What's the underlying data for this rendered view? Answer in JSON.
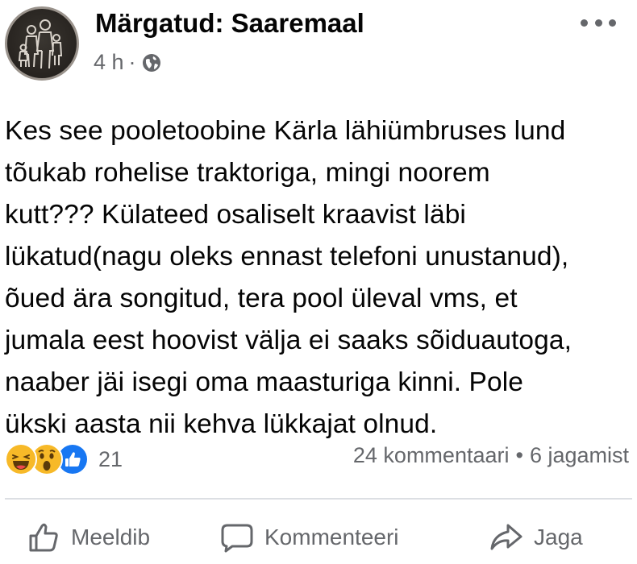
{
  "post": {
    "group_name": "Märgatud: Saaremaal",
    "time": "4 h",
    "separator": "·",
    "privacy_icon": "globe-icon",
    "more_icon": "more-options-icon",
    "text_lines": [
      "Kes see pooletoobine Kärla lähiümbruses lund",
      "tõukab rohelise traktoriga, mingi noorem",
      "kutt??? Külateed osaliselt kraavist läbi",
      "lükatud(nagu oleks ennast telefoni unustanud),",
      "õued ära songitud, tera pool üleval vms, et",
      "jumala eest hoovist välja ei saaks sõiduautoga,",
      "naaber jäi isegi oma maasturiga kinni. Pole",
      "ükski aasta nii kehva lükkajat olnud."
    ]
  },
  "reactions": {
    "icons": [
      "haha-reaction-icon",
      "wow-reaction-icon",
      "like-reaction-icon"
    ],
    "count": "21"
  },
  "stats": {
    "comments": "24 kommentaari",
    "bullet": "•",
    "shares": "6 jagamist"
  },
  "actions": {
    "like": "Meeldib",
    "comment": "Kommenteeri",
    "share": "Jaga"
  },
  "colors": {
    "text": "#050505",
    "secondary": "#65676b",
    "like_blue": "#1877f2",
    "reaction_yellow": "#f7b928",
    "divider": "#dcdfe3"
  }
}
